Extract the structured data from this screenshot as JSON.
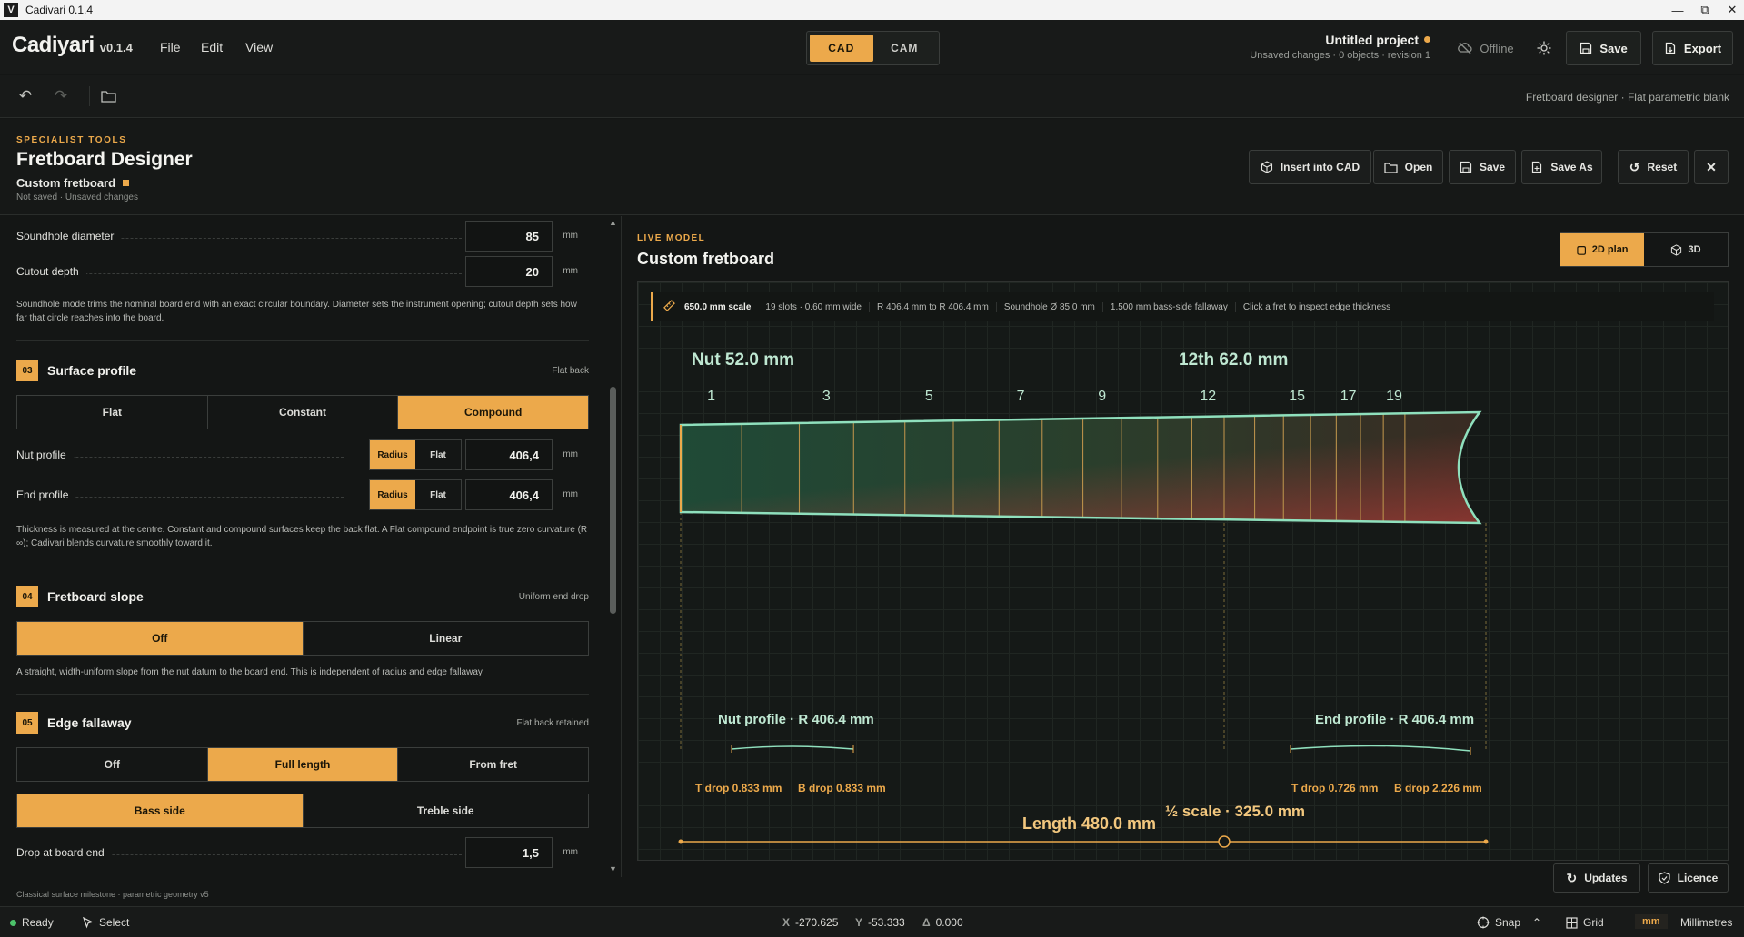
{
  "window": {
    "title": "Cadivari 0.1.4",
    "logo_letter": "V"
  },
  "app": {
    "name": "Cadiyari",
    "version": "v0.1.4"
  },
  "menu": [
    "File",
    "Edit",
    "View"
  ],
  "mode": {
    "cad": "CAD",
    "cam": "CAM",
    "active": "CAD"
  },
  "project": {
    "title": "Untitled project",
    "status": "Unsaved changes · 0 objects · revision 1"
  },
  "topbar": {
    "offline": "Offline",
    "save": "Save",
    "export": "Export"
  },
  "breadcrumb": "Fretboard designer · Flat parametric blank",
  "header": {
    "eyebrow": "SPECIALIST TOOLS",
    "title": "Fretboard Designer",
    "subtitle": "Custom fretboard",
    "meta": "Not saved · Unsaved changes",
    "buttons": {
      "insert": "Insert into CAD",
      "open": "Open",
      "save": "Save",
      "save_as": "Save As",
      "reset": "Reset"
    }
  },
  "panel": {
    "soundhole_diameter": {
      "label": "Soundhole diameter",
      "value": "85",
      "unit": "mm"
    },
    "cutout_depth": {
      "label": "Cutout depth",
      "value": "20",
      "unit": "mm"
    },
    "soundhole_note": "Soundhole mode trims the nominal board end with an exact circular boundary. Diameter sets the instrument opening; cutout depth sets how far that circle reaches into the board.",
    "surface": {
      "num": "03",
      "title": "Surface profile",
      "right": "Flat back",
      "options": [
        "Flat",
        "Constant",
        "Compound"
      ],
      "active": "Compound",
      "nut": {
        "label": "Nut profile",
        "radius": "Radius",
        "flat": "Flat",
        "value": "406,4",
        "unit": "mm"
      },
      "end": {
        "label": "End profile",
        "radius": "Radius",
        "flat": "Flat",
        "value": "406,4",
        "unit": "mm"
      },
      "note": "Thickness is measured at the centre. Constant and compound surfaces keep the back flat. A Flat compound endpoint is true zero curvature (R ∞); Cadivari blends curvature smoothly toward it."
    },
    "slope": {
      "num": "04",
      "title": "Fretboard slope",
      "right": "Uniform end drop",
      "options": [
        "Off",
        "Linear"
      ],
      "active": "Off",
      "note": "A straight, width-uniform slope from the nut datum to the board end. This is independent of radius and edge fallaway."
    },
    "fallaway": {
      "num": "05",
      "title": "Edge fallaway",
      "right": "Flat back retained",
      "options": [
        "Off",
        "Full length",
        "From fret"
      ],
      "active": "Full length",
      "side_options": [
        "Bass side",
        "Treble side"
      ],
      "side_active": "Bass side",
      "drop": {
        "label": "Drop at board end",
        "value": "1,5",
        "unit": "mm"
      }
    },
    "footer": "Classical surface milestone · parametric geometry v5"
  },
  "live": {
    "eyebrow": "LIVE MODEL",
    "title": "Custom fretboard",
    "view_2d": "2D plan",
    "view_3d": "3D",
    "info": {
      "scale": "650.0 mm scale",
      "slots": "19 slots · 0.60 mm wide",
      "radius": "R 406.4 mm to R 406.4 mm",
      "soundhole": "Soundhole Ø 85.0 mm",
      "fallaway": "1.500 mm bass-side fallaway",
      "hint": "Click a fret to inspect edge thickness"
    }
  },
  "drawing": {
    "nut_width": "Nut 52.0 mm",
    "twelfth_width": "12th 62.0 mm",
    "fret_numbers": [
      "1",
      "3",
      "5",
      "7",
      "9",
      "12",
      "15",
      "17",
      "19"
    ],
    "nut_profile": "Nut profile · R 406.4 mm",
    "end_profile": "End profile · R 406.4 mm",
    "nut_t_drop": "T drop 0.833 mm",
    "nut_b_drop": "B drop 0.833 mm",
    "end_t_drop": "T drop 0.726 mm",
    "end_b_drop": "B drop 2.226 mm",
    "half_scale": "½ scale · 325.0 mm",
    "length": "Length 480.0 mm"
  },
  "float_buttons": {
    "updates": "Updates",
    "licence": "Licence"
  },
  "status": {
    "ready": "Ready",
    "select": "Select",
    "x_label": "X",
    "x": "-270.625",
    "y_label": "Y",
    "y": "-53.333",
    "d_label": "Δ",
    "d": "0.000",
    "snap": "Snap",
    "grid": "Grid",
    "unit_badge": "mm",
    "unit": "Millimetres"
  },
  "colors": {
    "accent": "#eca94b",
    "outline": "#8fe0bd",
    "bg": "#141615"
  }
}
